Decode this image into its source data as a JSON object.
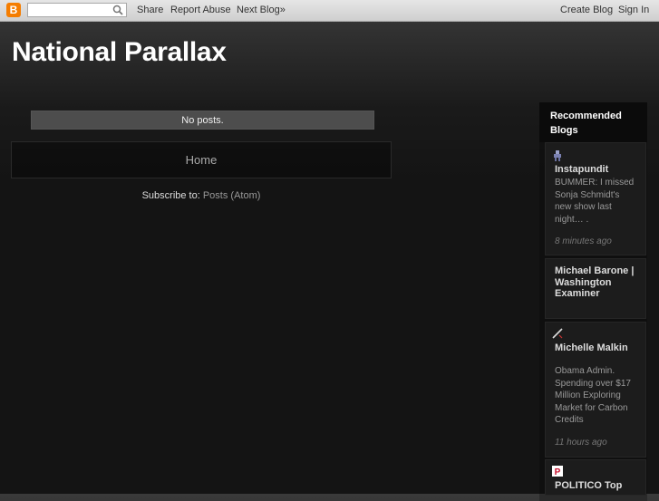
{
  "navbar": {
    "share": "Share",
    "report_abuse": "Report Abuse",
    "next_blog": "Next Blog»",
    "create_blog": "Create Blog",
    "sign_in": "Sign In",
    "logo_letter": "B",
    "search_placeholder": ""
  },
  "blog": {
    "title": "National Parallax"
  },
  "main": {
    "no_posts": "No posts.",
    "home": "Home",
    "subscribe_label": "Subscribe to:",
    "subscribe_link": "Posts (Atom)"
  },
  "sidebar": {
    "header": "Recommended Blogs",
    "blogs": [
      {
        "title": "Instapundit",
        "snippet": "BUMMER: I missed Sonja Schmidt's new show last night… .",
        "time": "8 minutes ago",
        "icon": "figure-icon"
      },
      {
        "title": "Michael Barone | Washington Examiner",
        "snippet": "",
        "time": "",
        "icon": ""
      },
      {
        "title": "Michelle Malkin",
        "snippet": "Obama Admin. Spending over $17 Million Exploring Market for Carbon Credits",
        "time": "11 hours ago",
        "icon": "pen-icon"
      },
      {
        "title": "POLITICO Top",
        "snippet": "",
        "time": "",
        "icon": "politico-icon"
      }
    ]
  },
  "colors": {
    "logo": "#f57d00",
    "politico": "#c8102e"
  }
}
